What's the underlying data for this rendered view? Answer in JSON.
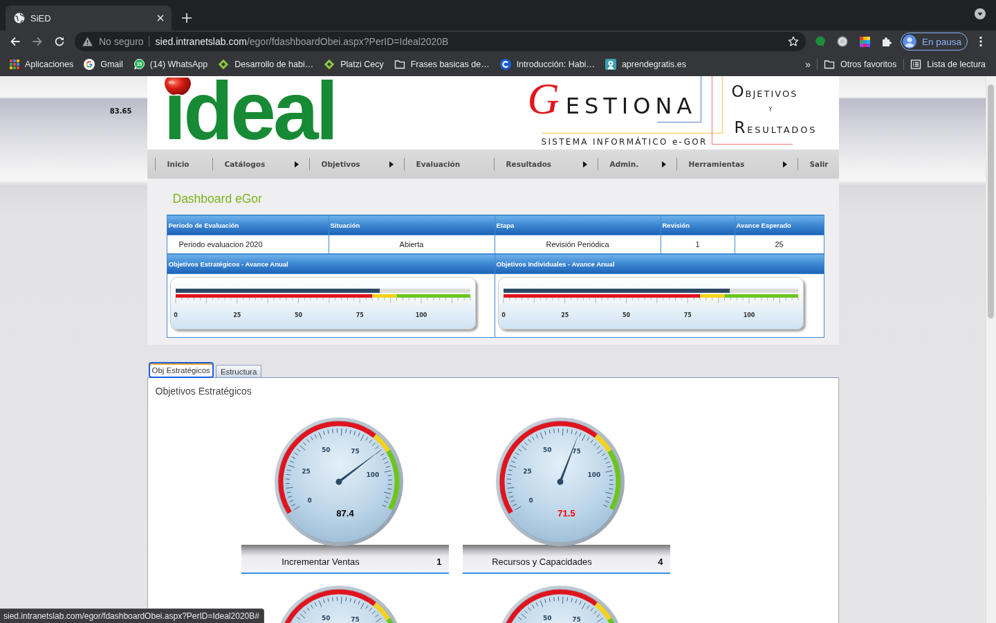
{
  "browser": {
    "tabs": [
      {
        "title": "SiED",
        "selected": true
      }
    ],
    "address": {
      "security": "No seguro",
      "host": "sied.intranetslab.com",
      "path": "/egor/fdashboardObei.aspx?PerID=Ideal2020B"
    },
    "profile": {
      "label": "En pausa"
    },
    "bookmarks": [
      {
        "kind": "apps",
        "label": "Aplicaciones"
      },
      {
        "kind": "google",
        "label": "Gmail"
      },
      {
        "kind": "chat",
        "label": "(14) WhatsApp",
        "badge": "15"
      },
      {
        "kind": "diamond",
        "label": "Desarrollo de habi…"
      },
      {
        "kind": "diamond",
        "label": "Platzi Cecy"
      },
      {
        "kind": "folder",
        "label": "Frases basicas de…"
      },
      {
        "kind": "course",
        "label": "Introducción: Habi…"
      },
      {
        "kind": "site",
        "label": "aprendegratis.es"
      }
    ],
    "more": "»",
    "bookmarks_end": [
      {
        "kind": "folder",
        "label": "Otros favoritos"
      },
      {
        "kind": "list",
        "label": "Lista de lectura"
      }
    ]
  },
  "side_value": "83.65",
  "header": {
    "logo": "ideal",
    "product": "GESTIONA",
    "subtitle": "SISTEMA INFORMÁTICO e-GOR",
    "tagline": [
      "OBJETIVOS",
      "Y",
      "RESULTADOS"
    ]
  },
  "menu": [
    {
      "label": "Inicio",
      "submenu": false
    },
    {
      "label": "Catálogos",
      "submenu": true
    },
    {
      "label": "Objetivos",
      "submenu": true
    },
    {
      "label": "Evaluación",
      "submenu": false
    },
    {
      "label": "Resultados",
      "submenu": true
    },
    {
      "label": "Admin.",
      "submenu": true
    },
    {
      "label": "Herramientas",
      "submenu": true
    },
    {
      "label": "Salir",
      "submenu": false
    }
  ],
  "dashboard": {
    "title": "Dashboard eGor",
    "table": {
      "columns": [
        "Periodo de Evaluación",
        "Situación",
        "Etapa",
        "Revisión",
        "Avance Esperado"
      ],
      "rows": [
        [
          "Periodo evaluacion 2020",
          "Abierta",
          "Revisión Periódica",
          "1",
          "25"
        ]
      ]
    },
    "progress": [
      {
        "title": "Objetivos Estratégicos - Avance Anual",
        "level": 0.693,
        "scale_labels": [
          "0",
          "25",
          "50",
          "75",
          "100"
        ]
      },
      {
        "title": "Objetivos Individuales - Avance Anual",
        "level": 0.768,
        "scale_labels": [
          "0",
          "25",
          "50",
          "75",
          "100"
        ]
      }
    ]
  },
  "tabs": [
    {
      "label": "Obj Estratégicos",
      "selected": true
    },
    {
      "label": "Estructura",
      "selected": false
    }
  ],
  "panel": {
    "title": "Objetivos Estratégicos",
    "gauges": [
      {
        "name": "Incrementar Ventas",
        "count": "1",
        "value": "87.4",
        "color": "#000000",
        "level": 0.728,
        "scale_labels": [
          "0",
          "25",
          "50",
          "75",
          "100"
        ]
      },
      {
        "name": "Recursos y Capacidades",
        "count": "4",
        "value": "71.5",
        "color": "#ff0000",
        "level": 0.596,
        "scale_labels": [
          "0",
          "25",
          "50",
          "75",
          "100"
        ]
      },
      {
        "scale_labels": [
          "50",
          "75"
        ]
      },
      {
        "scale_labels": [
          "50",
          "75"
        ]
      }
    ]
  },
  "status_bar": {
    "url": "sied.intranetslab.com/egor/fdashboardObei.aspx?PerID=Ideal2020B#"
  }
}
